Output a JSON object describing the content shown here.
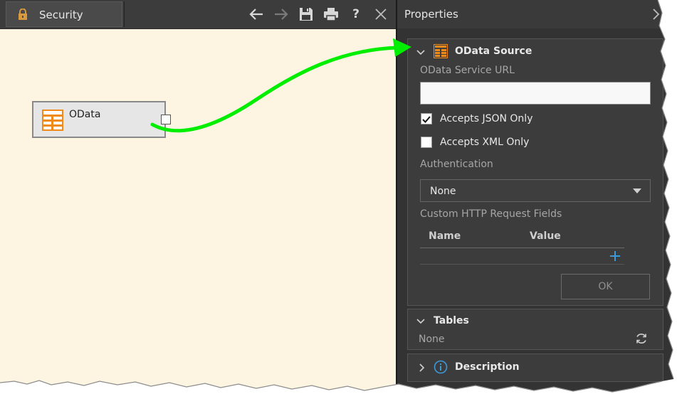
{
  "tab": {
    "label": "Security"
  },
  "toolbar": {
    "back": "arrow-left-icon",
    "forward": "arrow-right-icon",
    "save": "save-icon",
    "print": "print-icon",
    "help_label": "?",
    "close": "close-icon"
  },
  "node": {
    "label": "OData"
  },
  "panel": {
    "title": "Properties",
    "odata": {
      "title": "OData Source",
      "url_label": "OData Service URL",
      "url_value": "",
      "json_only_label": "Accepts JSON Only",
      "json_only_checked": true,
      "xml_only_label": "Accepts XML Only",
      "xml_only_checked": false,
      "auth_label": "Authentication",
      "auth_value": "None",
      "custom_label": "Custom HTTP Request Fields",
      "col_name": "Name",
      "col_value": "Value",
      "ok_label": "OK"
    },
    "tables": {
      "title": "Tables",
      "value": "None"
    },
    "description": {
      "title": "Description"
    }
  },
  "colors": {
    "arrow": "#00ee00",
    "accent_orange": "#f08a1a",
    "accent_blue": "#3a9ad9",
    "canvas_bg": "#fdf5e2",
    "panel_bg": "#333333"
  }
}
